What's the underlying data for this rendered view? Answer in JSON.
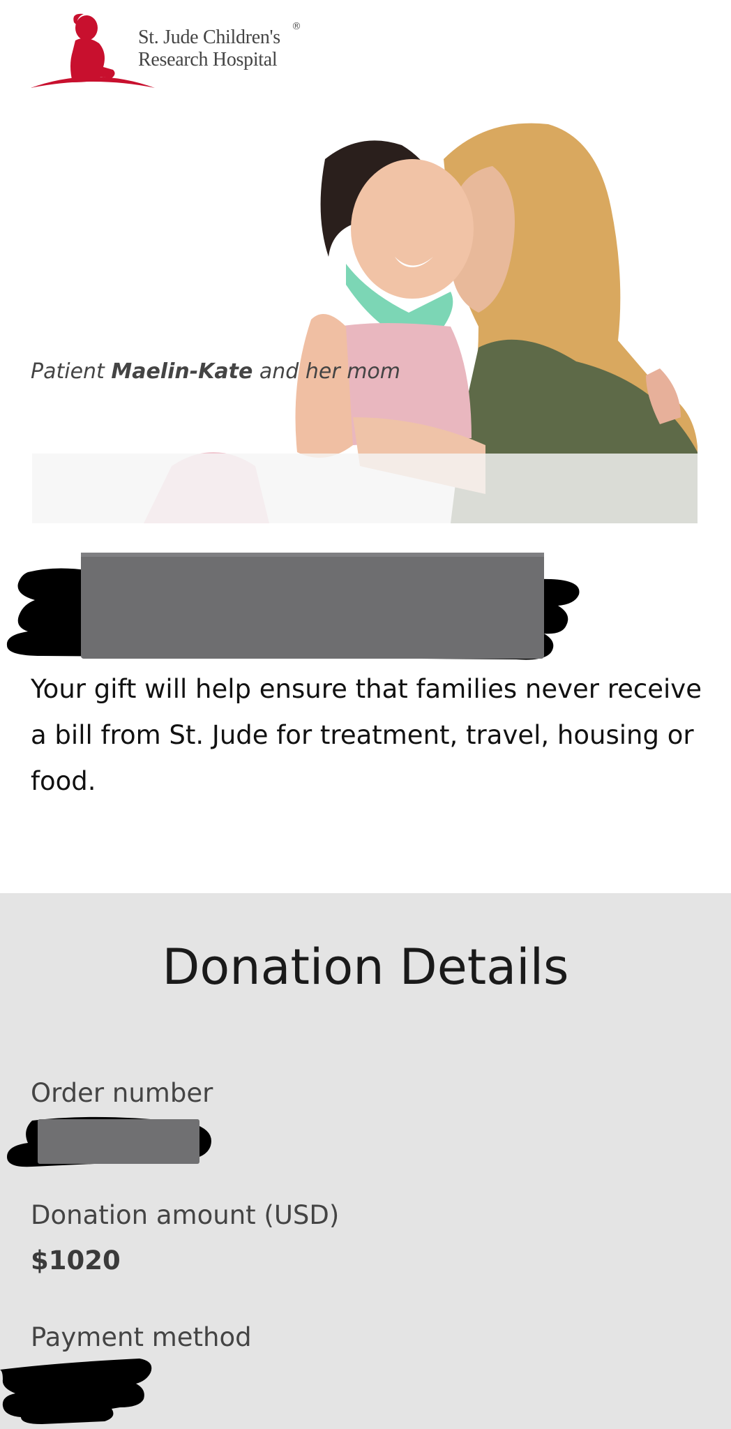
{
  "brand": {
    "name_line1": "St. Jude Children's",
    "name_line2": "Research Hospital",
    "registered": "®",
    "color": "#c8102e"
  },
  "hero": {
    "caption_prefix": "Patient ",
    "caption_name": "Maelin-Kate",
    "caption_suffix": " and her mom"
  },
  "intro": {
    "text": "Your gift will help ensure that families never receive a bill from St. Jude for treatment, travel, housing or food."
  },
  "details": {
    "title": "Donation Details",
    "order_number_label": "Order number",
    "amount_label": "Donation amount (USD)",
    "amount_value": "$1020",
    "payment_label": "Payment method"
  }
}
